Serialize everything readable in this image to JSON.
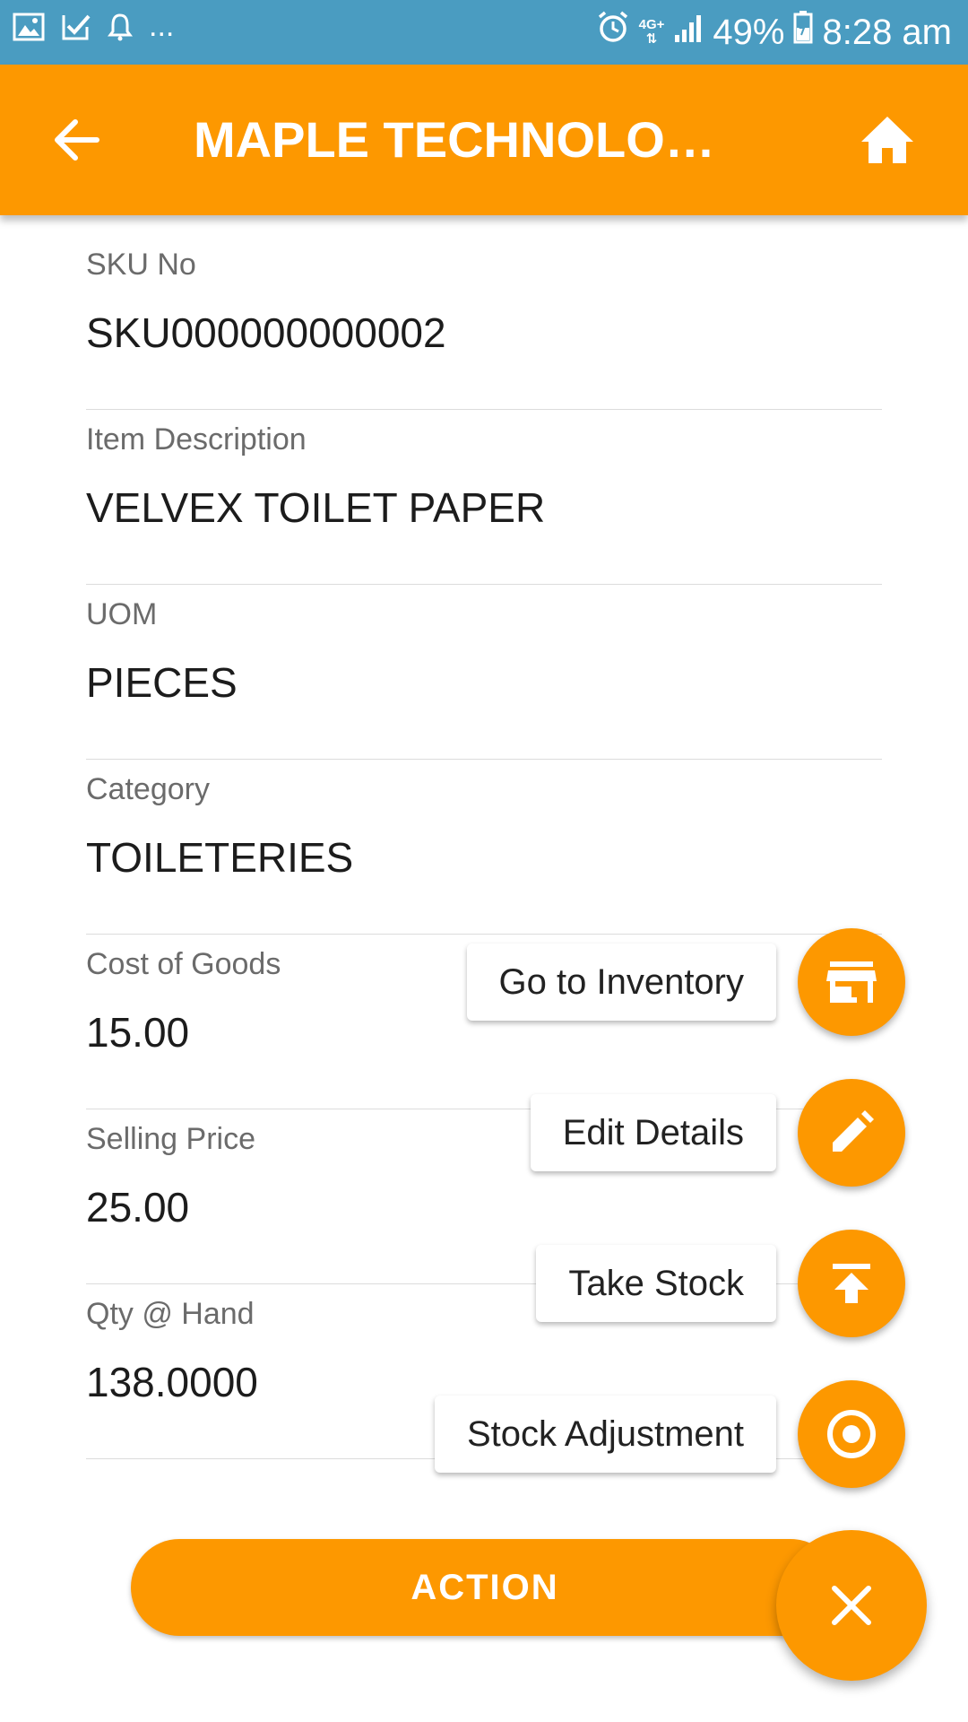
{
  "status_bar": {
    "left_icons": [
      "gallery-icon",
      "check-icon",
      "bell-icon"
    ],
    "overflow": "...",
    "network": "4G+",
    "battery": "49%",
    "time": "8:28 am"
  },
  "app_bar": {
    "title": "MAPLE TECHNOLOGIES",
    "back_icon": "arrow-back-icon",
    "home_icon": "home-icon"
  },
  "fields": [
    {
      "label": "SKU No",
      "value": "SKU000000000002"
    },
    {
      "label": "Item Description",
      "value": "VELVEX TOILET PAPER"
    },
    {
      "label": "UOM",
      "value": "PIECES"
    },
    {
      "label": "Category",
      "value": "TOILETERIES"
    },
    {
      "label": "Cost of Goods",
      "value": "15.00"
    },
    {
      "label": "Selling Price",
      "value": "25.00"
    },
    {
      "label": "Qty @ Hand",
      "value": "138.0000"
    }
  ],
  "fab_menu": [
    {
      "label": "Go to Inventory",
      "icon": "store-icon"
    },
    {
      "label": "Edit Details",
      "icon": "pencil-icon"
    },
    {
      "label": "Take Stock",
      "icon": "upload-icon"
    },
    {
      "label": "Stock Adjustment",
      "icon": "target-icon"
    }
  ],
  "action_label": "ACTION",
  "close_icon": "close-icon",
  "colors": {
    "primary": "#fd9800",
    "status_bar": "#4a9cc1"
  }
}
